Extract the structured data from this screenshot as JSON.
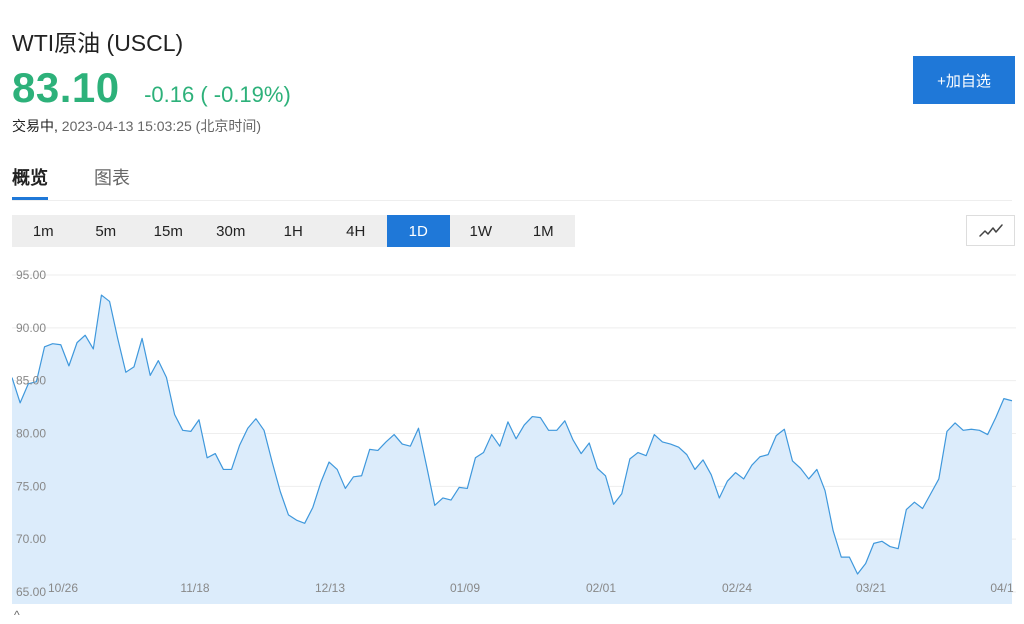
{
  "header": {
    "title": "WTI原油 (USCL)",
    "price": "83.10",
    "change": "-0.16 ( -0.19%)",
    "status": "交易中,",
    "timestamp": "2023-04-13 15:03:25 (北京时间)",
    "add_button": "+加自选"
  },
  "tabs": [
    {
      "label": "概览",
      "active": true
    },
    {
      "label": "图表",
      "active": false
    }
  ],
  "timeframes": [
    {
      "label": "1m",
      "active": false
    },
    {
      "label": "5m",
      "active": false
    },
    {
      "label": "15m",
      "active": false
    },
    {
      "label": "30m",
      "active": false
    },
    {
      "label": "1H",
      "active": false
    },
    {
      "label": "4H",
      "active": false
    },
    {
      "label": "1D",
      "active": true
    },
    {
      "label": "1W",
      "active": false
    },
    {
      "label": "1M",
      "active": false
    }
  ],
  "colors": {
    "up_green": "#2db17a",
    "accent_blue": "#1f78d8",
    "line_blue": "#3f98dc",
    "area_fill": "#dcecfb"
  },
  "chart_data": {
    "type": "area",
    "title": "",
    "xlabel": "",
    "ylabel": "",
    "ylim": [
      65,
      95
    ],
    "grid": true,
    "y_ticks": [
      "95.00",
      "90.00",
      "85.00",
      "80.00",
      "75.00",
      "70.00",
      "65.00"
    ],
    "x_ticks": [
      "10/26",
      "11/18",
      "12/13",
      "01/09",
      "02/01",
      "02/24",
      "03/21",
      "04/1"
    ],
    "series": [
      {
        "values": [
          85.3,
          82.9,
          84.7,
          84.9,
          88.2,
          88.5,
          88.4,
          86.4,
          88.6,
          89.3,
          88.0,
          93.1,
          92.5,
          89.0,
          85.8,
          86.3,
          89.0,
          85.5,
          86.9,
          85.3,
          81.8,
          80.3,
          80.2,
          81.3,
          77.7,
          78.1,
          76.6,
          76.6,
          78.9,
          80.5,
          81.4,
          80.3,
          77.3,
          74.5,
          72.3,
          71.8,
          71.5,
          73.0,
          75.4,
          77.3,
          76.6,
          74.8,
          75.9,
          76.0,
          78.5,
          78.4,
          79.2,
          79.9,
          79.0,
          78.8,
          80.5,
          76.9,
          73.2,
          73.9,
          73.7,
          74.9,
          74.8,
          77.7,
          78.2,
          79.9,
          78.8,
          81.1,
          79.5,
          80.8,
          81.6,
          81.5,
          80.3,
          80.3,
          81.2,
          79.4,
          78.1,
          79.1,
          76.7,
          76.0,
          73.3,
          74.3,
          77.6,
          78.2,
          77.9,
          79.9,
          79.2,
          79.0,
          78.7,
          78.0,
          76.6,
          77.5,
          76.1,
          73.9,
          75.5,
          76.3,
          75.7,
          77.0,
          77.8,
          78.0,
          79.8,
          80.4,
          77.4,
          76.7,
          75.7,
          76.6,
          74.6,
          70.8,
          68.3,
          68.3,
          66.7,
          67.7,
          69.6,
          69.8,
          69.3,
          69.1,
          72.8,
          73.5,
          72.9,
          74.3,
          75.7,
          80.2,
          81.0,
          80.3,
          80.4,
          80.3,
          79.9,
          81.5,
          83.3,
          83.1
        ]
      }
    ]
  }
}
